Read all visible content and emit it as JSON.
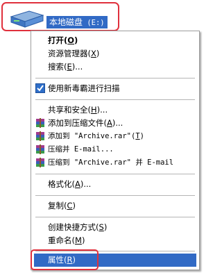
{
  "drive": {
    "label_main": "本地磁盘",
    "label_key": " (E:)",
    "icon": "hard-drive-icon"
  },
  "menu": {
    "open": {
      "label": "打开",
      "key": "O",
      "open_paren": "(",
      "close_paren": ")"
    },
    "explorer": {
      "label": "资源管理器",
      "key": "X"
    },
    "search": {
      "label": "搜索",
      "key": "E",
      "suffix": "..."
    },
    "scan": {
      "label": "使用新毒霸进行扫描",
      "icon": "shield-check-icon"
    },
    "share": {
      "label": "共享和安全",
      "key": "H",
      "suffix": "..."
    },
    "add_archive": {
      "label": "添加到压缩文件",
      "key": "A",
      "suffix": "...",
      "icon": "winrar-icon"
    },
    "add_to_rar": {
      "label": "添加到 \"Archive.rar\"",
      "key": "T",
      "icon": "winrar-icon"
    },
    "compress_email": {
      "label": "压缩并 E-mail...",
      "icon": "winrar-icon"
    },
    "compress_rar_email": {
      "label": "压缩到 \"Archive.rar\" 并 E-mail",
      "icon": "winrar-icon"
    },
    "format": {
      "label": "格式化",
      "key": "A",
      "suffix": "..."
    },
    "copy": {
      "label": "复制",
      "key": "C"
    },
    "shortcut": {
      "label": "创建快捷方式",
      "key": "S"
    },
    "rename": {
      "label": "重命名",
      "key": "M"
    },
    "properties": {
      "label": "属性",
      "key": "R"
    }
  },
  "colors": {
    "selection": "#316ac5",
    "highlight_box": "#e0303c"
  }
}
